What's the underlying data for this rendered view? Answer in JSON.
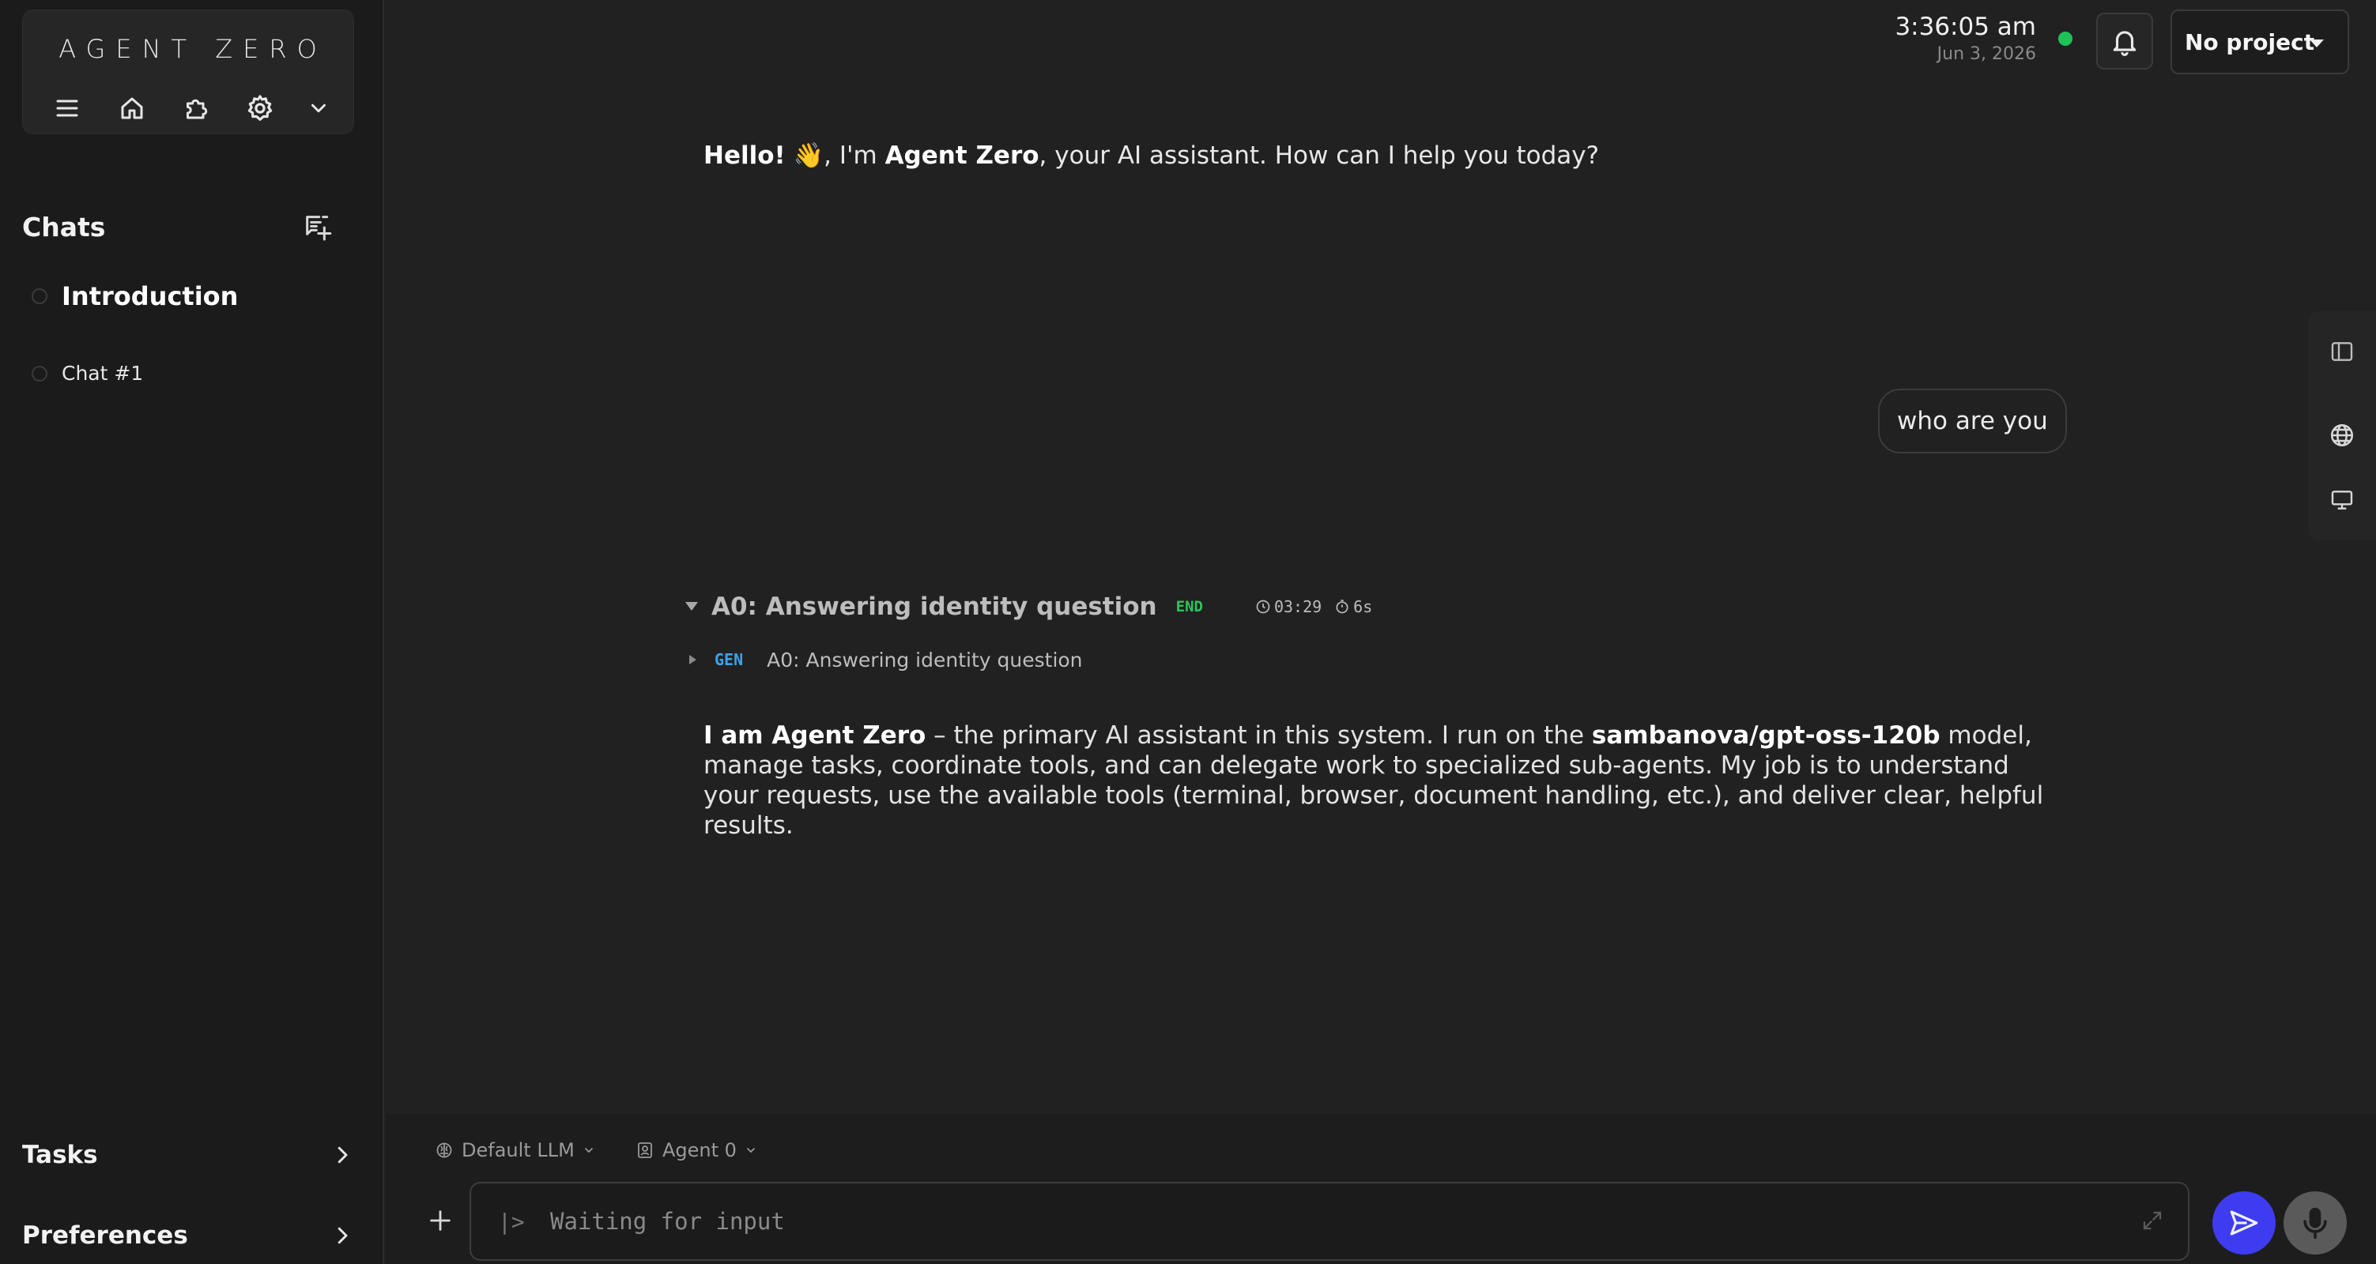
{
  "app": {
    "logo_text": "AGENT ZERO"
  },
  "sidebar": {
    "chats_heading": "Chats",
    "chats": [
      {
        "label": "Introduction",
        "active": true
      },
      {
        "label": "Chat #1",
        "active": false
      }
    ],
    "tasks_label": "Tasks",
    "preferences_label": "Preferences"
  },
  "header": {
    "time": "3:36:05 am",
    "date": "Jun 3, 2026",
    "status_color": "#1fc257",
    "project_label": "No project"
  },
  "messages": {
    "greeting": {
      "hello": "Hello!",
      "emoji": "👋",
      "text_1": ", I'm ",
      "name": "Agent Zero",
      "text_2": ", your AI assistant. How can I help you today?"
    },
    "user_message": "who are you",
    "process": {
      "title": "A0: Answering identity question",
      "badge": "END",
      "time": "03:29",
      "duration": "6s",
      "step": {
        "badge": "GEN",
        "label": "A0: Answering identity question"
      }
    },
    "answer": {
      "bold_intro": "I am Agent Zero",
      "text_1": " – the primary AI assistant in this system. I run on the ",
      "model": "sambanova/gpt-oss-120b",
      "text_2": " model, manage tasks, coordinate tools, and can delegate work to specialized sub-agents. My job is to understand your requests, use the available tools (terminal, browser, document handling, etc.), and deliver clear, helpful results."
    }
  },
  "composer": {
    "llm_label": "Default LLM",
    "agent_label": "Agent 0",
    "prompt_symbol": "|>",
    "placeholder": "Waiting for input",
    "send_color": "#3d3cf0"
  },
  "icons": {
    "brand": [
      "menu-icon",
      "home-icon",
      "puzzle-icon",
      "gear-icon",
      "chevron-down-icon"
    ],
    "rail": [
      "sidebar-panel-icon",
      "globe-icon",
      "monitor-icon"
    ]
  }
}
